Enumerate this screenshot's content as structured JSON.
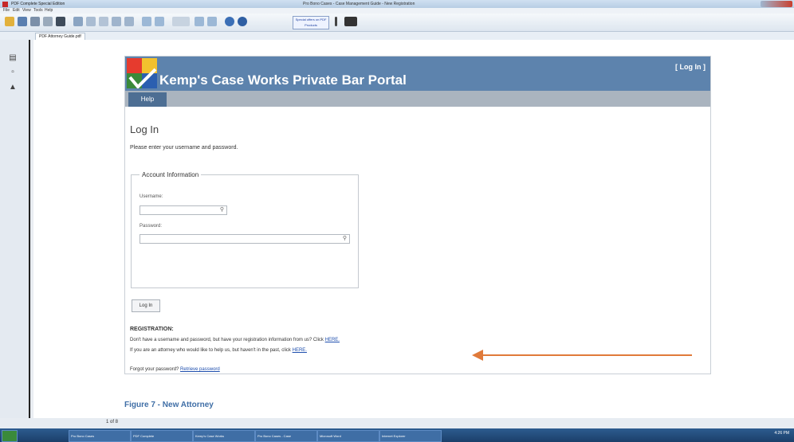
{
  "window": {
    "app_title": "PDF Complete Special Edition",
    "doc_title": "Pro Bono Cases - Case Management Guide - New Registration"
  },
  "menubar": [
    "File",
    "Edit",
    "View",
    "Tools",
    "Help"
  ],
  "toolbar": {
    "banner_text": "Special offers on PDF Products"
  },
  "doc_tab": "PDF Attorney Guide.pdf",
  "portal": {
    "title": "Kemp's Case Works Private Bar Portal",
    "login_link": "[ Log In ]",
    "nav_help": "Help",
    "heading": "Log In",
    "instructions": "Please enter your username and password.",
    "fieldset_legend": "Account Information",
    "username_label": "Username:",
    "password_label": "Password:",
    "login_button": "Log In",
    "registration_heading": "REGISTRATION:",
    "reg_line1_text": "Don't have a username and password, but have your registration information from us? Click",
    "reg_line1_link": "HERE.",
    "reg_line2_text": "If you are an attorney who would like to help us, but haven't in the past, click",
    "reg_line2_link": "HERE.",
    "forgot_text": "Forgot your password?",
    "forgot_link": "Retrieve password"
  },
  "caption": "Figure 7 - New Attorney",
  "statusbar": {
    "page_indicator": "1 of 8"
  },
  "taskbar": {
    "items": [
      "Pro Bono Cases",
      "PDF Complete",
      "Kemp's Case Works",
      "Pro Bono Cases - Case",
      "Microsoft Word",
      "Internet Explorer"
    ],
    "clock": "4:26 PM"
  },
  "colors": {
    "header_blue": "#5d83ad",
    "arrow_orange": "#e07a3a",
    "link_blue": "#1f4fae"
  }
}
